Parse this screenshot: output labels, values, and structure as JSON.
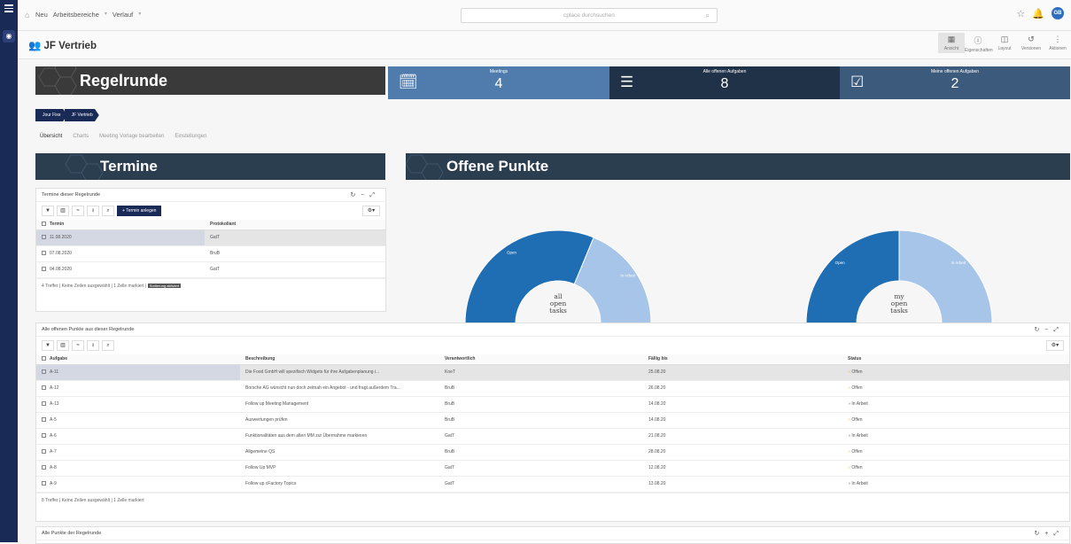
{
  "topbar": {
    "nav": [
      "Neu",
      "Arbeitsbereiche",
      "Verlauf"
    ],
    "search_placeholder": "cplace durchsuchen",
    "avatar": "GB"
  },
  "page": {
    "title": "JF Vertrieb",
    "tools": [
      {
        "icon": "▦",
        "label": "Ansicht"
      },
      {
        "icon": "ⓘ",
        "label": "Eigenschaften"
      },
      {
        "icon": "◫",
        "label": "Layout"
      },
      {
        "icon": "↺",
        "label": "Versionen"
      },
      {
        "icon": "⋮",
        "label": "Aktionen"
      }
    ]
  },
  "banner": {
    "title": "Regelrunde"
  },
  "stats": [
    {
      "label": "Meetings",
      "value": "4",
      "color": "#4f7cad",
      "icon": "calendar-check-icon"
    },
    {
      "label": "Alle offenen Aufgaben",
      "value": "8",
      "color": "#1f3248",
      "icon": "list-icon"
    },
    {
      "label": "Meine offenen Aufgaben",
      "value": "2",
      "color": "#3b5a7c",
      "icon": "checkbox-icon"
    }
  ],
  "breadcrumb": [
    "Jour Fixe",
    "JF Vertrieb"
  ],
  "tabs": [
    "Übersicht",
    "Charts",
    "Meeting Vorlage bearbeiten",
    "Einstellungen"
  ],
  "sections": {
    "termine": "Termine",
    "offene": "Offene Punkte"
  },
  "termine_panel": {
    "title": "Termine dieser Regelrunde",
    "add_label": "Termin anlegen",
    "columns": [
      "Termin",
      "Protokollant"
    ],
    "rows": [
      [
        "11.08.2020",
        "GatT"
      ],
      [
        "07.08.2020",
        "BruB"
      ],
      [
        "04.08.2020",
        "GatT"
      ]
    ],
    "footer": "4 Treffer | Keine Zeilen ausgewählt | 1 Zelle markiert",
    "footer_tag": "Sortierung aktiviert"
  },
  "chart_data": [
    {
      "type": "pie",
      "center_label": [
        "all",
        "open",
        "tasks"
      ],
      "labels": [
        "Open",
        "In Arbeit"
      ],
      "values": [
        5,
        3
      ],
      "colors": [
        "#1f6db3",
        "#a6c5e8"
      ]
    },
    {
      "type": "pie",
      "center_label": [
        "my",
        "open",
        "tasks"
      ],
      "labels": [
        "Open",
        "In Arbeit"
      ],
      "values": [
        1,
        1
      ],
      "colors": [
        "#1f6db3",
        "#a6c5e8"
      ]
    }
  ],
  "aufgaben_panel": {
    "title": "Alle offenen Punkte aus dieser Regelrunde",
    "columns": [
      "Aufgabe",
      "Beschreibung",
      "Verantwortlich",
      "Fällig bis",
      "Status"
    ],
    "rows": [
      [
        "A-11",
        "Die Food GmbH will spezifisch Widgets für ihre Aufgabenplanung i...",
        "KoeT",
        "25.08.20",
        "Offen"
      ],
      [
        "A-12",
        "Borsche AG wünscht nun doch zeitnah ein Angebot - und fragt außerdem Tra...",
        "BruB",
        "26.08.20",
        "Offen"
      ],
      [
        "A-13",
        "Follow up Meeting Management",
        "BruB",
        "14.08.20",
        "In Arbeit"
      ],
      [
        "A-5",
        "Auswertungen prüfen",
        "BruB",
        "14.08.20",
        "Offen"
      ],
      [
        "A-6",
        "Funktionalitäten aus dem alten MM zur Übernahme markieren",
        "GatT",
        "21.08.20",
        "In Arbeit"
      ],
      [
        "A-7",
        "Allgemeine QS",
        "BruB",
        "28.08.20",
        "Offen"
      ],
      [
        "A-8",
        "Follow Up MVP",
        "GatT",
        "12.08.20",
        "Offen"
      ],
      [
        "A-9",
        "Follow up cFactory Topics",
        "GatT",
        "13.08.20",
        "In Arbeit"
      ]
    ],
    "footer": "8 Treffer | Keine Zeilen ausgewählt | 1 Zelle markiert"
  },
  "alle_punkte": {
    "title": "Alle Punkte der Regelrunde"
  }
}
